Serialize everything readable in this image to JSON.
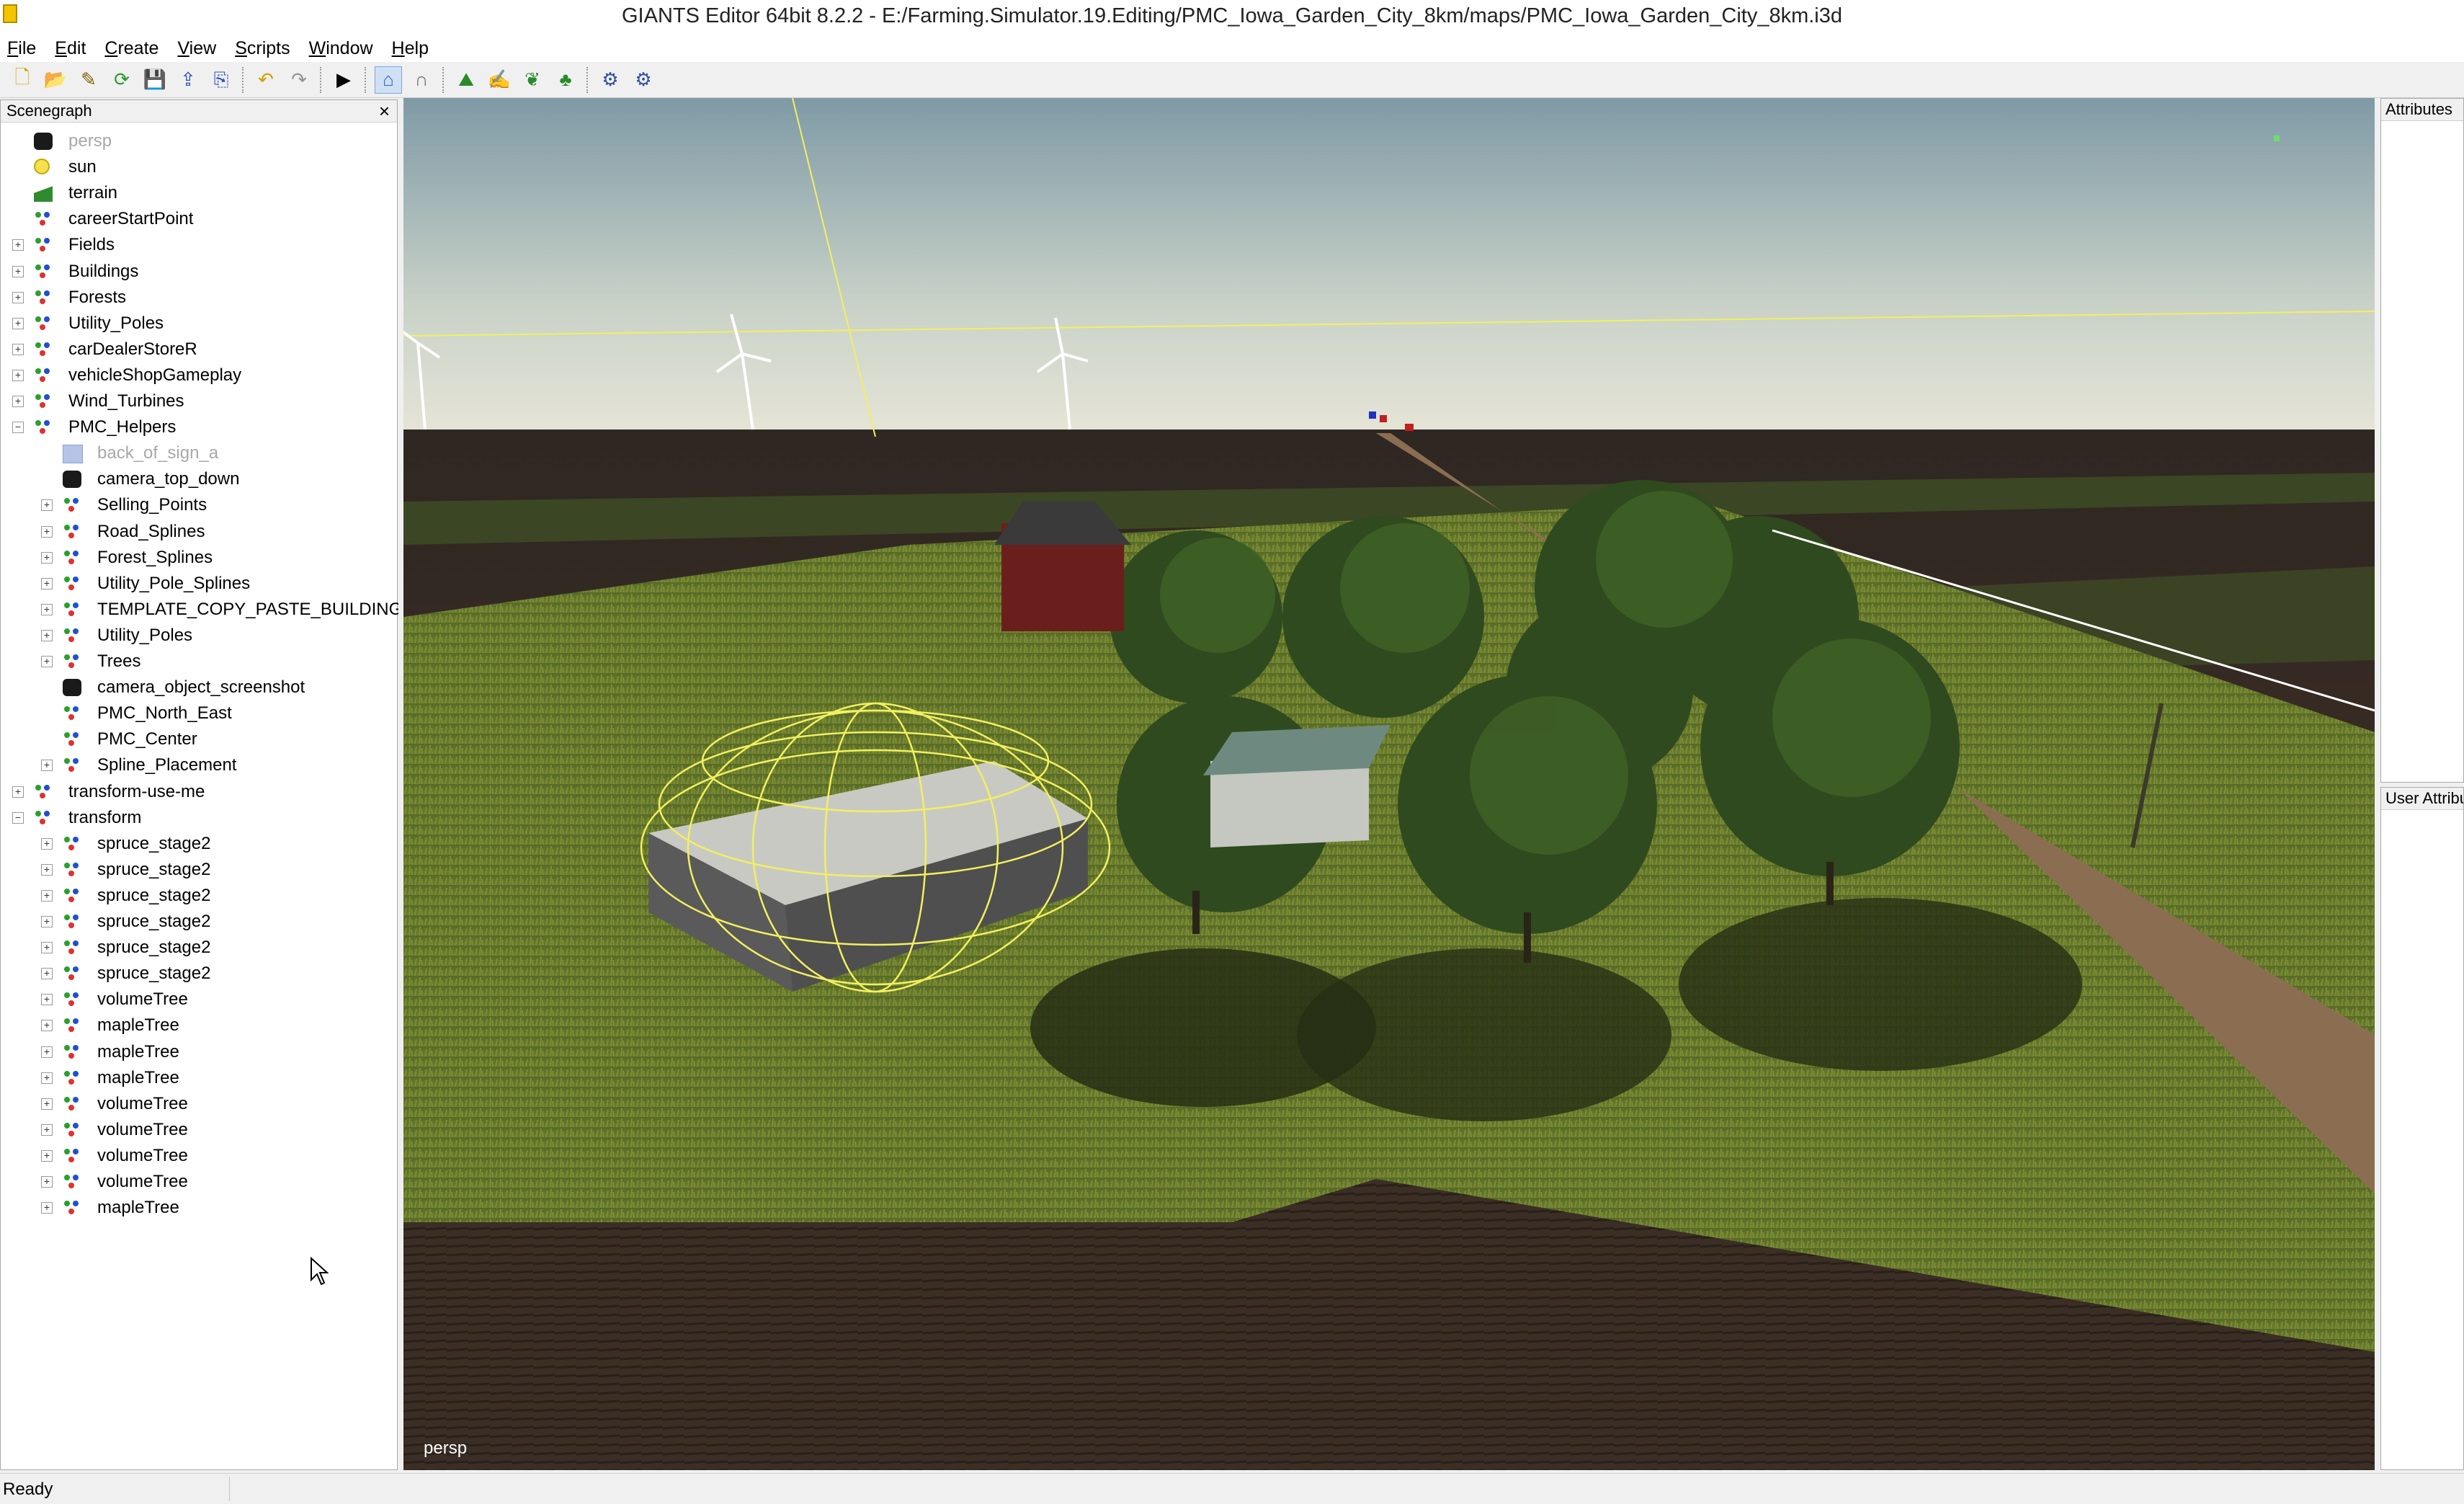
{
  "window": {
    "title": "GIANTS Editor 64bit 8.2.2 - E:/Farming.Simulator.19.Editing/PMC_Iowa_Garden_City_8km/maps/PMC_Iowa_Garden_City_8km.i3d"
  },
  "menu": [
    {
      "label": "File",
      "underline": "F",
      "rest": "ile"
    },
    {
      "label": "Edit",
      "underline": "E",
      "rest": "dit"
    },
    {
      "label": "Create",
      "underline": "C",
      "rest": "reate"
    },
    {
      "label": "View",
      "underline": "V",
      "rest": "iew"
    },
    {
      "label": "Scripts",
      "underline": "S",
      "rest": "cripts"
    },
    {
      "label": "Window",
      "underline": "W",
      "rest": "indow"
    },
    {
      "label": "Help",
      "underline": "H",
      "rest": "elp"
    }
  ],
  "toolbar": {
    "icons": [
      "new-file-icon",
      "open-folder-icon",
      "edit-icon",
      "refresh-icon",
      "save-icon",
      "export-icon",
      "import-icon",
      "undo-icon",
      "redo-icon",
      "play-icon",
      "select-tool-icon",
      "move-tool-icon",
      "terrain-sculpt-icon",
      "terrain-paint-icon",
      "foliage-paint-icon",
      "tree-paint-icon",
      "sync-icon",
      "settings-icon"
    ]
  },
  "scenegraph": {
    "title": "Scenegraph",
    "close": "×",
    "nodes": [
      {
        "label": "persp",
        "level": 1,
        "icon": "camera",
        "dim": true,
        "expand": ""
      },
      {
        "label": "sun",
        "level": 1,
        "icon": "sun",
        "expand": ""
      },
      {
        "label": "terrain",
        "level": 1,
        "icon": "terrain",
        "expand": ""
      },
      {
        "label": "careerStartPoint",
        "level": 1,
        "icon": "transform",
        "expand": ""
      },
      {
        "label": "Fields",
        "level": 1,
        "icon": "transform",
        "expand": "+"
      },
      {
        "label": "Buildings",
        "level": 1,
        "icon": "transform",
        "expand": "+"
      },
      {
        "label": "Forests",
        "level": 1,
        "icon": "transform",
        "expand": "+"
      },
      {
        "label": "Utility_Poles",
        "level": 1,
        "icon": "transform",
        "expand": "+"
      },
      {
        "label": "carDealerStoreR",
        "level": 1,
        "icon": "transform",
        "expand": "+"
      },
      {
        "label": "vehicleShopGameplay",
        "level": 1,
        "icon": "transform",
        "expand": "+"
      },
      {
        "label": "Wind_Turbines",
        "level": 1,
        "icon": "transform",
        "expand": "+"
      },
      {
        "label": "PMC_Helpers",
        "level": 1,
        "icon": "transform",
        "expand": "−"
      },
      {
        "label": "back_of_sign_a",
        "level": 2,
        "icon": "shape",
        "dim": true,
        "expand": ""
      },
      {
        "label": "camera_top_down",
        "level": 2,
        "icon": "camera",
        "expand": ""
      },
      {
        "label": "Selling_Points",
        "level": 2,
        "icon": "transform",
        "expand": "+"
      },
      {
        "label": "Road_Splines",
        "level": 2,
        "icon": "transform",
        "expand": "+"
      },
      {
        "label": "Forest_Splines",
        "level": 2,
        "icon": "transform",
        "expand": "+"
      },
      {
        "label": "Utility_Pole_Splines",
        "level": 2,
        "icon": "transform",
        "expand": "+"
      },
      {
        "label": "TEMPLATE_COPY_PASTE_BUILDING",
        "level": 2,
        "icon": "transform",
        "expand": "+"
      },
      {
        "label": "Utility_Poles",
        "level": 2,
        "icon": "transform",
        "expand": "+"
      },
      {
        "label": "Trees",
        "level": 2,
        "icon": "transform",
        "expand": "+"
      },
      {
        "label": "camera_object_screenshot",
        "level": 2,
        "icon": "camera",
        "expand": ""
      },
      {
        "label": "PMC_North_East",
        "level": 2,
        "icon": "transform",
        "expand": ""
      },
      {
        "label": "PMC_Center",
        "level": 2,
        "icon": "transform",
        "expand": ""
      },
      {
        "label": "Spline_Placement",
        "level": 2,
        "icon": "transform",
        "expand": "+"
      },
      {
        "label": "transform-use-me",
        "level": 1,
        "icon": "transform",
        "expand": "+"
      },
      {
        "label": "transform",
        "level": 1,
        "icon": "transform",
        "expand": "−"
      },
      {
        "label": "spruce_stage2",
        "level": 2,
        "icon": "transform",
        "expand": "+"
      },
      {
        "label": "spruce_stage2",
        "level": 2,
        "icon": "transform",
        "expand": "+"
      },
      {
        "label": "spruce_stage2",
        "level": 2,
        "icon": "transform",
        "expand": "+"
      },
      {
        "label": "spruce_stage2",
        "level": 2,
        "icon": "transform",
        "expand": "+"
      },
      {
        "label": "spruce_stage2",
        "level": 2,
        "icon": "transform",
        "expand": "+"
      },
      {
        "label": "spruce_stage2",
        "level": 2,
        "icon": "transform",
        "expand": "+"
      },
      {
        "label": "volumeTree",
        "level": 2,
        "icon": "transform",
        "expand": "+"
      },
      {
        "label": "mapleTree",
        "level": 2,
        "icon": "transform",
        "expand": "+"
      },
      {
        "label": "mapleTree",
        "level": 2,
        "icon": "transform",
        "expand": "+"
      },
      {
        "label": "mapleTree",
        "level": 2,
        "icon": "transform",
        "expand": "+"
      },
      {
        "label": "volumeTree",
        "level": 2,
        "icon": "transform",
        "expand": "+"
      },
      {
        "label": "volumeTree",
        "level": 2,
        "icon": "transform",
        "expand": "+"
      },
      {
        "label": "volumeTree",
        "level": 2,
        "icon": "transform",
        "expand": "+"
      },
      {
        "label": "volumeTree",
        "level": 2,
        "icon": "transform",
        "expand": "+"
      },
      {
        "label": "mapleTree",
        "level": 2,
        "icon": "transform",
        "expand": "+"
      }
    ]
  },
  "viewport": {
    "camera_label": "persp"
  },
  "panels": {
    "attributes": "Attributes",
    "user_attributes": "User Attributes"
  },
  "status": {
    "text": "Ready"
  },
  "colors": {
    "selection_wire": "#f2f060",
    "sky_top": "#7f9aa6",
    "grass": "#5e7028",
    "soil": "#3a2c22"
  }
}
